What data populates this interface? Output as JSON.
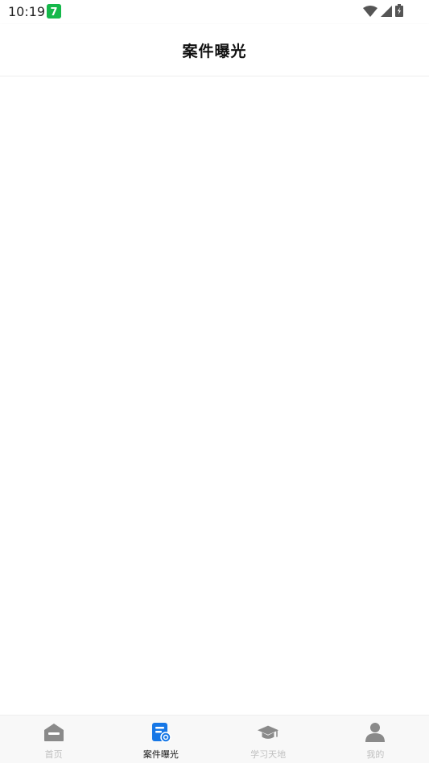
{
  "status_bar": {
    "time": "10:19",
    "app_badge": "7"
  },
  "header": {
    "title": "案件曝光"
  },
  "tabbar": {
    "tabs": [
      {
        "label": "首页",
        "icon": "home-icon",
        "active": false
      },
      {
        "label": "案件曝光",
        "icon": "case-exposure-icon",
        "active": true
      },
      {
        "label": "学习天地",
        "icon": "graduation-cap-icon",
        "active": false
      },
      {
        "label": "我的",
        "icon": "user-icon",
        "active": false
      }
    ]
  },
  "colors": {
    "accent": "#1677e6",
    "tab_inactive_icon": "#8a8a8a",
    "tab_inactive_label": "#c0c0c0",
    "tab_active_label": "#111111",
    "app_badge": "#15b84a"
  }
}
